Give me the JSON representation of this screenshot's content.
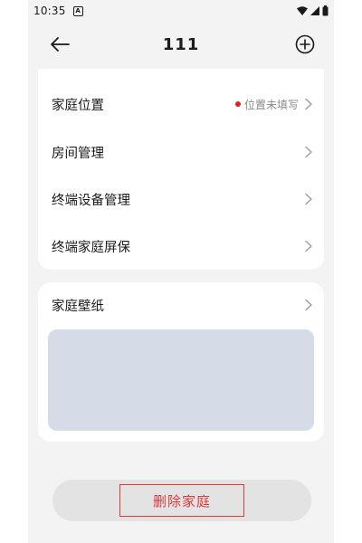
{
  "status_bar": {
    "time": "10:35",
    "notification_icon": "a-box-icon",
    "icons": [
      "wifi-icon",
      "cellular-signal-icon",
      "battery-icon"
    ]
  },
  "header": {
    "title": "111",
    "back_icon": "arrow-left-icon",
    "add_icon": "plus-circle-icon"
  },
  "settings": {
    "items": [
      {
        "label": "家庭位置",
        "hint": "位置未填写",
        "hint_dot_color": "#e02020"
      },
      {
        "label": "房间管理"
      },
      {
        "label": "终端设备管理"
      },
      {
        "label": "终端家庭屏保"
      }
    ]
  },
  "wallpaper": {
    "label": "家庭壁纸",
    "preview_color": "#d5dce8"
  },
  "actions": {
    "delete_label": "删除家庭",
    "delete_color": "#e03a3a"
  }
}
